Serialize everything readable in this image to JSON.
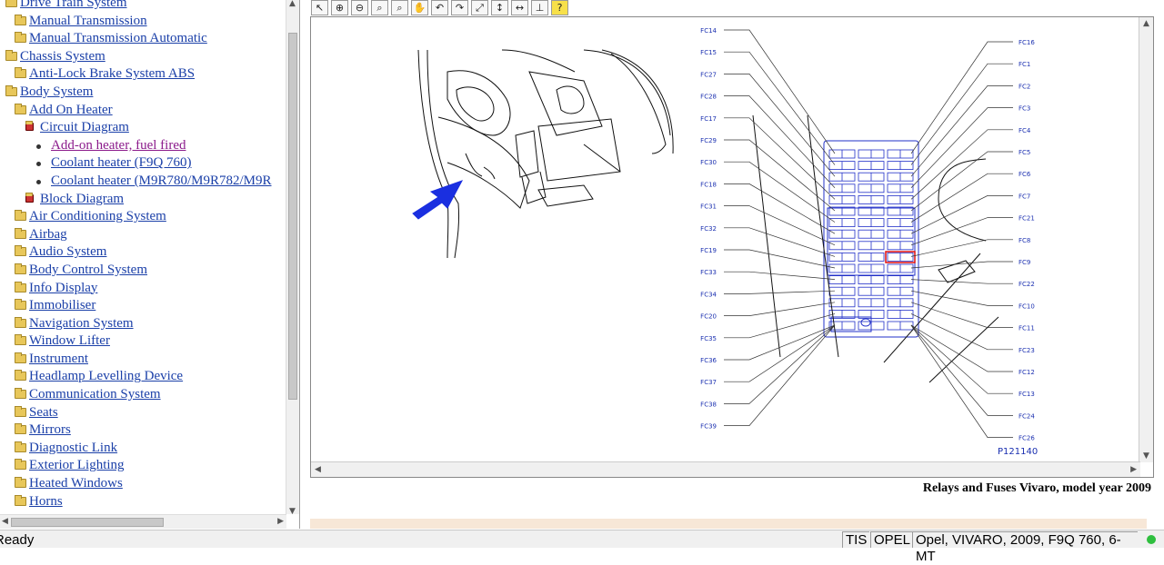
{
  "tree": [
    {
      "level": 1,
      "icon": "folder",
      "label": "Drive Train System"
    },
    {
      "level": 2,
      "icon": "folder",
      "label": "Manual Transmission"
    },
    {
      "level": 2,
      "icon": "folder",
      "label": "Manual Transmission Automatic"
    },
    {
      "level": 1,
      "icon": "folder",
      "label": "Chassis System"
    },
    {
      "level": 2,
      "icon": "folder",
      "label": "Anti-Lock Brake System ABS"
    },
    {
      "level": 1,
      "icon": "folder",
      "label": "Body System"
    },
    {
      "level": 2,
      "icon": "folder",
      "label": "Add On Heater"
    },
    {
      "level": 3,
      "icon": "diagram",
      "label": "Circuit Diagram"
    },
    {
      "level": 4,
      "icon": "dot",
      "label": "Add-on heater, fuel fired",
      "visited": true
    },
    {
      "level": 4,
      "icon": "dot",
      "label": "Coolant heater (F9Q 760)"
    },
    {
      "level": 4,
      "icon": "dot",
      "label": "Coolant heater (M9R780/M9R782/M9R"
    },
    {
      "level": 3,
      "icon": "diagram",
      "label": "Block Diagram"
    },
    {
      "level": 2,
      "icon": "folder",
      "label": "Air Conditioning System"
    },
    {
      "level": 2,
      "icon": "folder",
      "label": "Airbag"
    },
    {
      "level": 2,
      "icon": "folder",
      "label": "Audio System"
    },
    {
      "level": 2,
      "icon": "folder",
      "label": "Body Control System"
    },
    {
      "level": 2,
      "icon": "folder",
      "label": "Info Display"
    },
    {
      "level": 2,
      "icon": "folder",
      "label": "Immobiliser"
    },
    {
      "level": 2,
      "icon": "folder",
      "label": "Navigation System"
    },
    {
      "level": 2,
      "icon": "folder",
      "label": "Window Lifter"
    },
    {
      "level": 2,
      "icon": "folder",
      "label": "Instrument"
    },
    {
      "level": 2,
      "icon": "folder",
      "label": "Headlamp Levelling Device"
    },
    {
      "level": 2,
      "icon": "folder",
      "label": "Communication System"
    },
    {
      "level": 2,
      "icon": "folder",
      "label": "Seats"
    },
    {
      "level": 2,
      "icon": "folder",
      "label": "Mirrors"
    },
    {
      "level": 2,
      "icon": "folder",
      "label": "Diagnostic Link"
    },
    {
      "level": 2,
      "icon": "folder",
      "label": "Exterior Lighting"
    },
    {
      "level": 2,
      "icon": "folder",
      "label": "Heated Windows"
    },
    {
      "level": 2,
      "icon": "folder",
      "label": "Horns"
    }
  ],
  "toolbar": {
    "tools": [
      {
        "name": "select-arrow-tool",
        "glyph": "↖"
      },
      {
        "name": "zoom-in-tool",
        "glyph": "⊕"
      },
      {
        "name": "zoom-out-tool",
        "glyph": "⊖"
      },
      {
        "name": "zoom-area-tool",
        "glyph": "⌕"
      },
      {
        "name": "zoom-fit-tool",
        "glyph": "⌕"
      },
      {
        "name": "pan-hand-tool",
        "glyph": "✋"
      },
      {
        "name": "rotate-left-tool",
        "glyph": "↶"
      },
      {
        "name": "rotate-right-tool",
        "glyph": "↷"
      },
      {
        "name": "fit-window-tool",
        "glyph": "⤢"
      },
      {
        "name": "fit-height-tool",
        "glyph": "↕"
      },
      {
        "name": "fit-width-tool",
        "glyph": "↔"
      },
      {
        "name": "measure-tool",
        "glyph": "⊥"
      },
      {
        "name": "help-tool",
        "glyph": "?"
      }
    ]
  },
  "diagram": {
    "left_labels": [
      "FC14",
      "FC15",
      "FC27",
      "FC28",
      "FC17",
      "FC29",
      "FC30",
      "FC18",
      "FC31",
      "FC32",
      "FC19",
      "FC33",
      "FC34",
      "FC20",
      "FC35",
      "FC36",
      "FC37",
      "FC38",
      "FC39"
    ],
    "right_labels": [
      "FC16",
      "FC1",
      "FC2",
      "FC3",
      "FC4",
      "FC5",
      "FC6",
      "FC7",
      "FC21",
      "FC8",
      "FC9",
      "FC22",
      "FC10",
      "FC11",
      "FC23",
      "FC12",
      "FC13",
      "FC24",
      "FC26"
    ],
    "figure_id": "P121140",
    "caption": "Relays and Fuses Vivaro, model year 2009"
  },
  "status": {
    "ready": "Ready",
    "system": "TIS",
    "brand": "OPEL",
    "vehicle": "Opel, VIVARO, 2009, F9Q 760, 6-MT"
  }
}
